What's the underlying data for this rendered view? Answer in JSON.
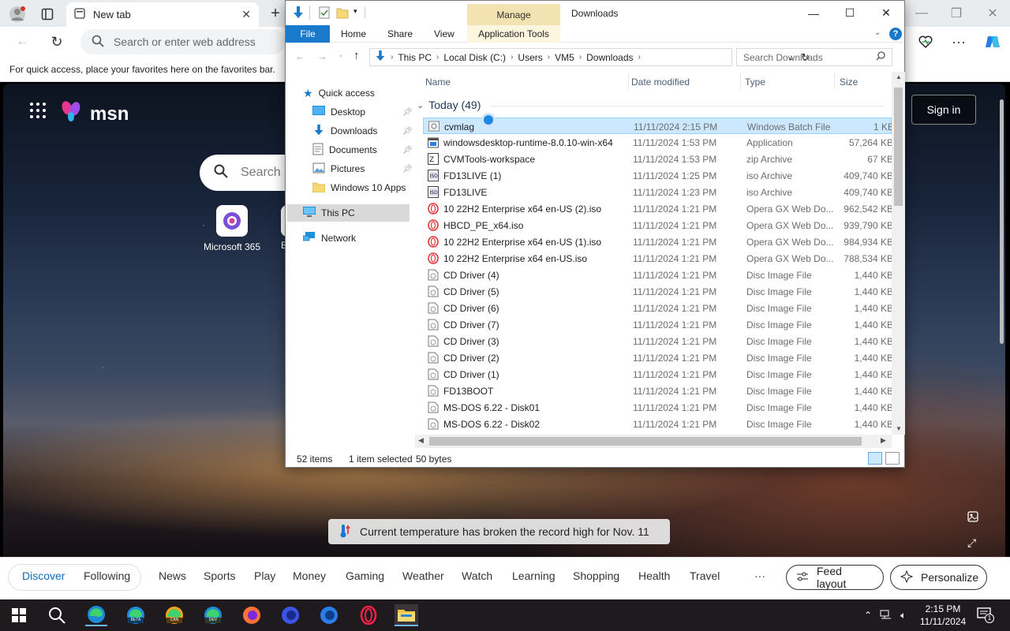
{
  "browser": {
    "tab_title": "New tab",
    "address_placeholder": "Search or enter web address",
    "favorites_hint": "For quick access, place your favorites here on the favorites bar."
  },
  "msn": {
    "logo": "msn",
    "search_placeholder": "Search",
    "apps": [
      {
        "label": "Microsoft 365"
      },
      {
        "label": "E"
      }
    ],
    "sign_in": "Sign in",
    "banner": "Current temperature has broken the record high for Nov. 11",
    "nav": [
      "Discover",
      "Following",
      "News",
      "Sports",
      "Play",
      "Money",
      "Gaming",
      "Weather",
      "Watch",
      "Learning",
      "Shopping",
      "Health",
      "Travel",
      "···"
    ],
    "feed_layout": "Feed layout",
    "personalize": "Personalize"
  },
  "explorer": {
    "manage_tab": "Manage",
    "window_title": "Downloads",
    "ribbon_tabs": [
      "File",
      "Home",
      "Share",
      "View",
      "Application Tools"
    ],
    "breadcrumb": [
      "This PC",
      "Local Disk (C:)",
      "Users",
      "VM5",
      "Downloads"
    ],
    "search_placeholder": "Search Downloads",
    "nav_pane": {
      "quick_access": "Quick access",
      "pinned": [
        "Desktop",
        "Downloads",
        "Documents",
        "Pictures"
      ],
      "windows10apps": "Windows 10 Apps",
      "this_pc": "This PC",
      "network": "Network"
    },
    "columns": [
      "Name",
      "Date modified",
      "Type",
      "Size"
    ],
    "group_label": "Today (49)",
    "files": [
      {
        "name": "cvmlag",
        "date": "11/11/2024 2:15 PM",
        "type": "Windows Batch File",
        "size": "1 KB",
        "icon": "batch"
      },
      {
        "name": "windowsdesktop-runtime-8.0.10-win-x64",
        "date": "11/11/2024 1:53 PM",
        "type": "Application",
        "size": "57,264 KB",
        "icon": "app"
      },
      {
        "name": "CVMTools-workspace",
        "date": "11/11/2024 1:53 PM",
        "type": "zip Archive",
        "size": "67 KB",
        "icon": "zip"
      },
      {
        "name": "FD13LIVE (1)",
        "date": "11/11/2024 1:25 PM",
        "type": "iso Archive",
        "size": "409,740 KB",
        "icon": "iso"
      },
      {
        "name": "FD13LIVE",
        "date": "11/11/2024 1:23 PM",
        "type": "iso Archive",
        "size": "409,740 KB",
        "icon": "iso"
      },
      {
        "name": "10 22H2 Enterprise x64 en-US (2).iso",
        "date": "11/11/2024 1:21 PM",
        "type": "Opera GX Web Do...",
        "size": "962,542 KB",
        "icon": "opera"
      },
      {
        "name": "HBCD_PE_x64.iso",
        "date": "11/11/2024 1:21 PM",
        "type": "Opera GX Web Do...",
        "size": "939,790 KB",
        "icon": "opera"
      },
      {
        "name": "10 22H2 Enterprise x64 en-US (1).iso",
        "date": "11/11/2024 1:21 PM",
        "type": "Opera GX Web Do...",
        "size": "984,934 KB",
        "icon": "opera"
      },
      {
        "name": "10 22H2 Enterprise x64 en-US.iso",
        "date": "11/11/2024 1:21 PM",
        "type": "Opera GX Web Do...",
        "size": "788,534 KB",
        "icon": "opera"
      },
      {
        "name": "CD Driver (4)",
        "date": "11/11/2024 1:21 PM",
        "type": "Disc Image File",
        "size": "1,440 KB",
        "icon": "disc"
      },
      {
        "name": "CD Driver (5)",
        "date": "11/11/2024 1:21 PM",
        "type": "Disc Image File",
        "size": "1,440 KB",
        "icon": "disc"
      },
      {
        "name": "CD Driver (6)",
        "date": "11/11/2024 1:21 PM",
        "type": "Disc Image File",
        "size": "1,440 KB",
        "icon": "disc"
      },
      {
        "name": "CD Driver (7)",
        "date": "11/11/2024 1:21 PM",
        "type": "Disc Image File",
        "size": "1,440 KB",
        "icon": "disc"
      },
      {
        "name": "CD Driver (3)",
        "date": "11/11/2024 1:21 PM",
        "type": "Disc Image File",
        "size": "1,440 KB",
        "icon": "disc"
      },
      {
        "name": "CD Driver (2)",
        "date": "11/11/2024 1:21 PM",
        "type": "Disc Image File",
        "size": "1,440 KB",
        "icon": "disc"
      },
      {
        "name": "CD Driver (1)",
        "date": "11/11/2024 1:21 PM",
        "type": "Disc Image File",
        "size": "1,440 KB",
        "icon": "disc"
      },
      {
        "name": "FD13BOOT",
        "date": "11/11/2024 1:21 PM",
        "type": "Disc Image File",
        "size": "1,440 KB",
        "icon": "disc"
      },
      {
        "name": "MS-DOS 6.22 - Disk01",
        "date": "11/11/2024 1:21 PM",
        "type": "Disc Image File",
        "size": "1,440 KB",
        "icon": "disc"
      },
      {
        "name": "MS-DOS 6.22 - Disk02",
        "date": "11/11/2024 1:21 PM",
        "type": "Disc Image File",
        "size": "1,440 KB",
        "icon": "disc"
      }
    ],
    "status": {
      "items": "52 items",
      "selected": "1 item selected",
      "bytes": "50 bytes"
    }
  },
  "taskbar": {
    "time": "2:15 PM",
    "date": "11/11/2024",
    "notification_count": "1",
    "badges": [
      "BETA",
      "CAN",
      "DEV"
    ]
  },
  "colors": {
    "accent": "#1979ca",
    "selection": "#cce8ff",
    "manage": "#f3e3b2",
    "taskbar": "#1e1a1e"
  }
}
